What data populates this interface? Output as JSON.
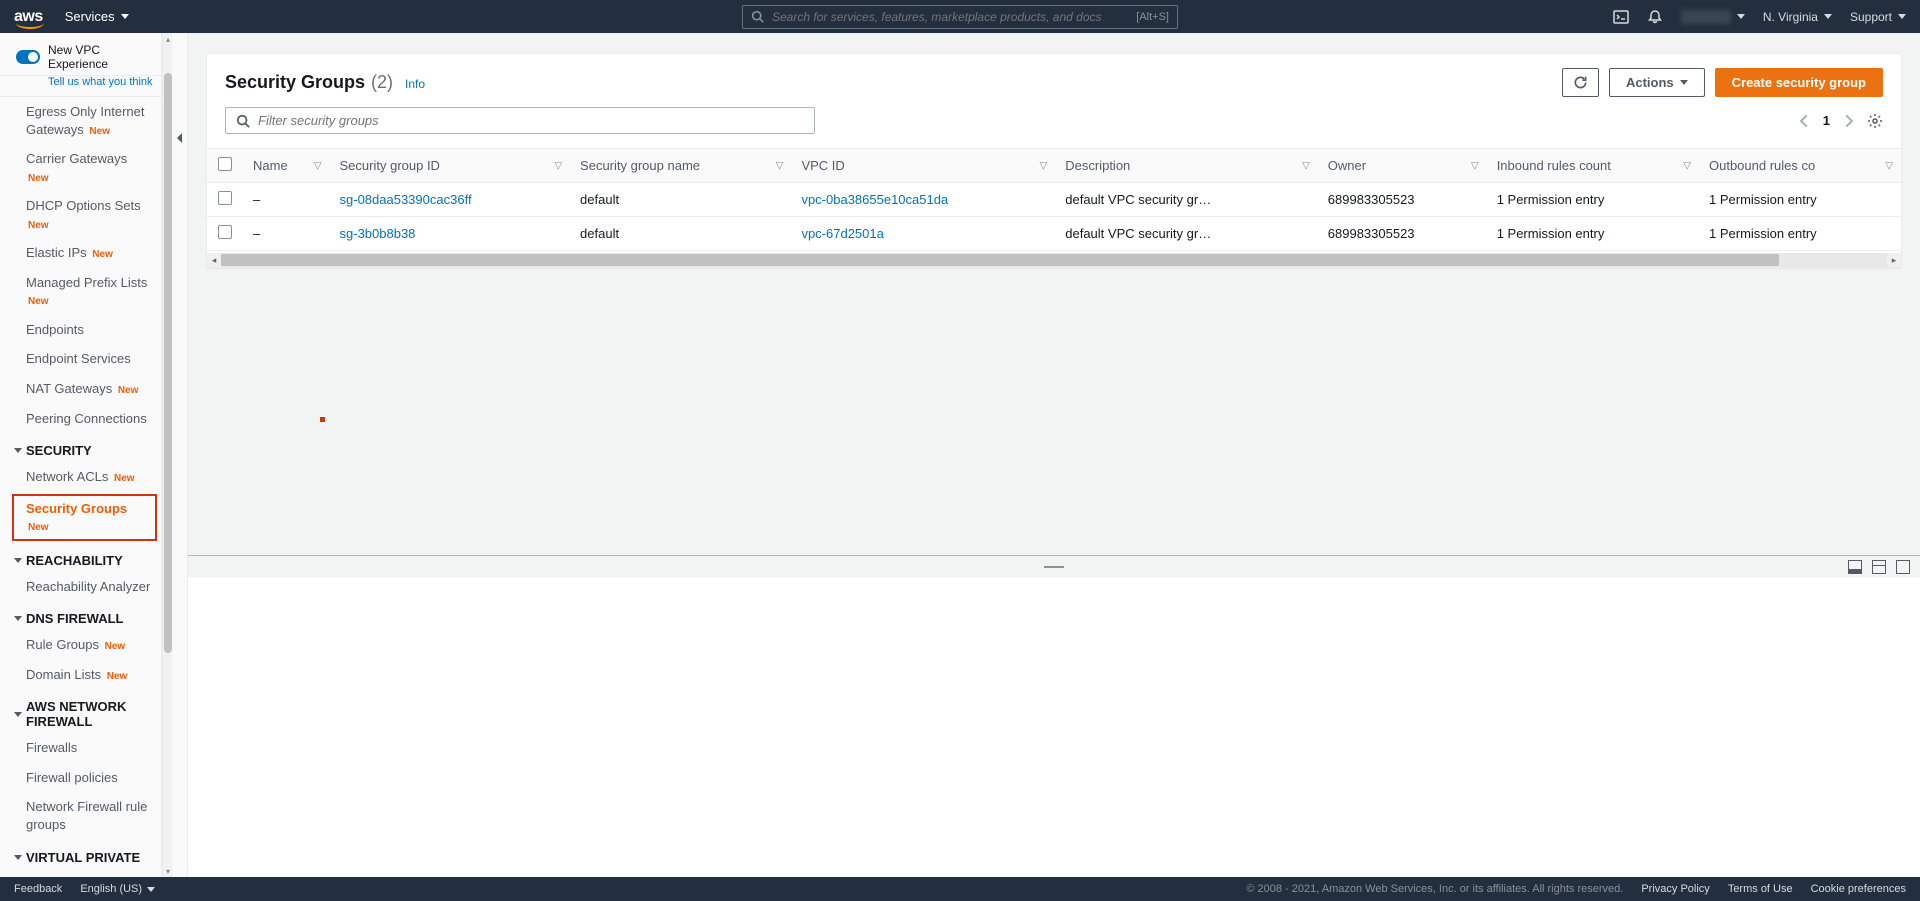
{
  "topnav": {
    "logo": "aws",
    "services": "Services",
    "search_placeholder": "Search for services, features, marketplace products, and docs",
    "search_kbd": "[Alt+S]",
    "region": "N. Virginia",
    "support": "Support"
  },
  "sidebar": {
    "toggle_label": "New VPC Experience",
    "feedback": "Tell us what you think",
    "items": [
      {
        "label": "Egress Only Internet Gateways",
        "new": true
      },
      {
        "label": "Carrier Gateways",
        "new": true
      },
      {
        "label": "DHCP Options Sets",
        "new": true
      },
      {
        "label": "Elastic IPs",
        "new": true
      },
      {
        "label": "Managed Prefix Lists",
        "new": true
      },
      {
        "label": "Endpoints"
      },
      {
        "label": "Endpoint Services"
      },
      {
        "label": "NAT Gateways",
        "new": true
      },
      {
        "label": "Peering Connections"
      }
    ],
    "sections": [
      {
        "title": "SECURITY",
        "items": [
          {
            "label": "Network ACLs",
            "new": true
          },
          {
            "label": "Security Groups",
            "new": true,
            "active": true
          }
        ]
      },
      {
        "title": "REACHABILITY",
        "items": [
          {
            "label": "Reachability Analyzer"
          }
        ]
      },
      {
        "title": "DNS FIREWALL",
        "items": [
          {
            "label": "Rule Groups",
            "new": true
          },
          {
            "label": "Domain Lists",
            "new": true
          }
        ]
      },
      {
        "title": "AWS NETWORK FIREWALL",
        "items": [
          {
            "label": "Firewalls"
          },
          {
            "label": "Firewall policies"
          },
          {
            "label": "Network Firewall rule groups"
          }
        ]
      },
      {
        "title": "VIRTUAL PRIVATE",
        "items": []
      }
    ]
  },
  "page": {
    "title": "Security Groups",
    "count": "(2)",
    "info": "Info",
    "actions_label": "Actions",
    "create_label": "Create security group",
    "filter_placeholder": "Filter security groups",
    "page_num": "1"
  },
  "table": {
    "columns": [
      "Name",
      "Security group ID",
      "Security group name",
      "VPC ID",
      "Description",
      "Owner",
      "Inbound rules count",
      "Outbound rules co"
    ],
    "rows": [
      {
        "name": "–",
        "sgid": "sg-08daa53390cac36ff",
        "sgname": "default",
        "vpc": "vpc-0ba38655e10ca51da",
        "desc": "default VPC security gr…",
        "owner": "689983305523",
        "inbound": "1 Permission entry",
        "outbound": "1 Permission entry"
      },
      {
        "name": "–",
        "sgid": "sg-3b0b8b38",
        "sgname": "default",
        "vpc": "vpc-67d2501a",
        "desc": "default VPC security gr…",
        "owner": "689983305523",
        "inbound": "1 Permission entry",
        "outbound": "1 Permission entry"
      }
    ]
  },
  "footer": {
    "feedback": "Feedback",
    "language": "English (US)",
    "copyright": "© 2008 - 2021, Amazon Web Services, Inc. or its affiliates. All rights reserved.",
    "links": [
      "Privacy Policy",
      "Terms of Use",
      "Cookie preferences"
    ]
  },
  "new_label": "New"
}
